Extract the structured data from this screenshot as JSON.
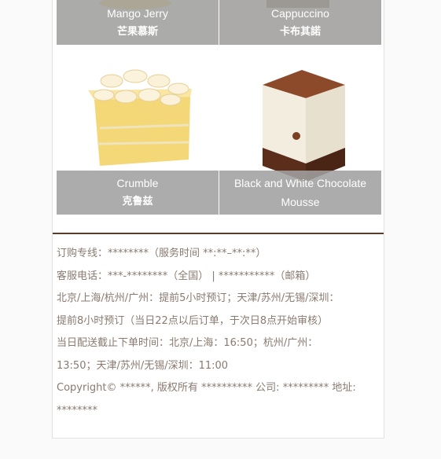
{
  "products": [
    {
      "en": "Mango Jerry",
      "zh": "芒果慕斯"
    },
    {
      "en": "Cappuccino",
      "zh": "卡布其諾"
    },
    {
      "en": "Crumble",
      "zh": "克鲁兹"
    },
    {
      "en": "Black and White Chocolate",
      "en2": "Mousse",
      "zh": ""
    }
  ],
  "footer": {
    "line1": "订购专线：********（服务时间 **:**–**:**）",
    "line2": "客服电话：***-********（全国） | ***********（邮箱）",
    "line3": "北京/上海/杭州/广州：提前5小时预订；天津/苏州/无锡/深圳：",
    "line4": "提前8小时预订（当日22点以后订单，于次日8点开始审核）",
    "line5": "当日配送截止下单时间：北京/上海：16:50；杭州/广州：",
    "line6": "13:50；天津/苏州/无锡/深圳：11:00",
    "line7": "Copyright© ******, 版权所有 ********** 公司: ********* 地址:",
    "line8": "********"
  },
  "colors": {
    "divider": "#5a3a2a",
    "caption_bg": "#a0a0a0",
    "footer_text": "#8a7a70"
  }
}
